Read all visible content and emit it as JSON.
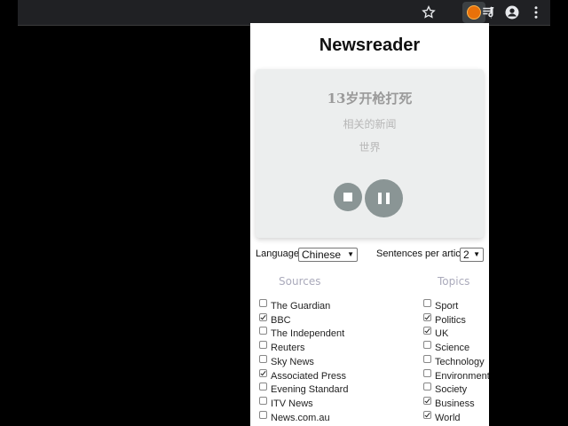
{
  "toolbar": {
    "icons": [
      "star-icon",
      "newsreader-extension-icon",
      "media-queue-icon",
      "profile-icon",
      "menu-dots-icon"
    ]
  },
  "popup": {
    "title": "Newsreader",
    "article": {
      "headline": "13岁开枪打死",
      "related": "相关的新闻",
      "section": "世界"
    },
    "language_label": "Language:",
    "language_value": "Chinese",
    "sentences_label": "Sentences per article:",
    "sentences_value": "2",
    "sources_heading": "Sources",
    "topics_heading": "Topics",
    "sources": [
      {
        "label": "The Guardian",
        "checked": false
      },
      {
        "label": "BBC",
        "checked": true
      },
      {
        "label": "The Independent",
        "checked": false
      },
      {
        "label": "Reuters",
        "checked": false
      },
      {
        "label": "Sky News",
        "checked": false
      },
      {
        "label": "Associated Press",
        "checked": true
      },
      {
        "label": "Evening Standard",
        "checked": false
      },
      {
        "label": "ITV News",
        "checked": false
      },
      {
        "label": "News.com.au",
        "checked": false
      }
    ],
    "topics": [
      {
        "label": "Sport",
        "checked": false
      },
      {
        "label": "Politics",
        "checked": true
      },
      {
        "label": "UK",
        "checked": true
      },
      {
        "label": "Science",
        "checked": false
      },
      {
        "label": "Technology",
        "checked": false
      },
      {
        "label": "Environment",
        "checked": false
      },
      {
        "label": "Society",
        "checked": false
      },
      {
        "label": "Business",
        "checked": true
      },
      {
        "label": "World",
        "checked": true
      }
    ]
  }
}
